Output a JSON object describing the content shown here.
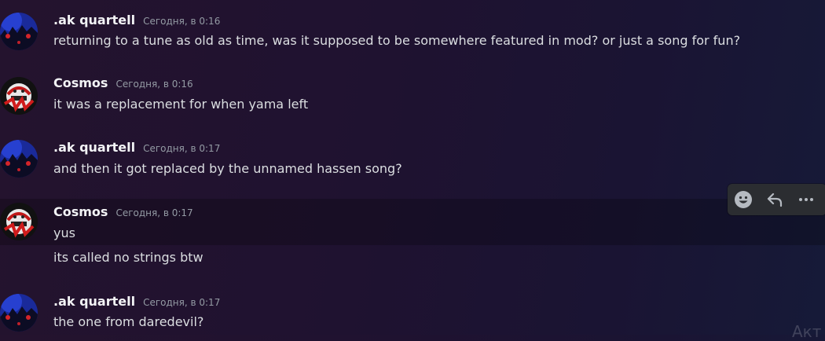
{
  "messages": [
    {
      "author": ".ak quartell",
      "timestamp": "Сегодня, в 0:16",
      "text": "returning to a tune as old as time, was it supposed to be somewhere featured in mod? or just a song for fun?"
    },
    {
      "author": "Cosmos",
      "timestamp": "Сегодня, в 0:16",
      "text": "it was a replacement for when yama left"
    },
    {
      "author": ".ak quartell",
      "timestamp": "Сегодня, в 0:17",
      "text": "and then it got replaced by the unnamed hassen song?"
    },
    {
      "author": "Cosmos",
      "timestamp": "Сегодня, в 0:17",
      "text": "yus"
    },
    {
      "text": "its called no strings btw"
    },
    {
      "author": ".ak quartell",
      "timestamp": "Сегодня, в 0:17",
      "text": "the one from daredevil?"
    }
  ],
  "toolbar": {
    "icons": [
      "emoji-reaction-icon",
      "reply-icon",
      "more-options-icon"
    ]
  },
  "watermark": "Акт",
  "colors": {
    "author": "#f2f3f5",
    "timestamp": "#949ba4",
    "text": "#dbdee1",
    "toolbar_bg": "#2b2d31"
  }
}
